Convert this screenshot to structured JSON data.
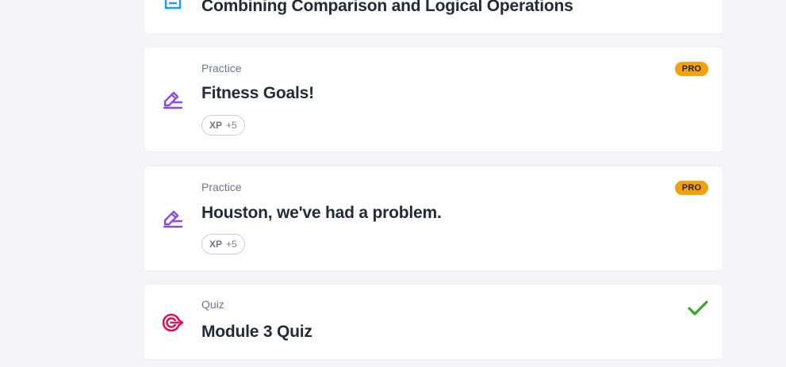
{
  "cards": [
    {
      "type_label": "",
      "title": "Combining Comparison and Logical Operations",
      "icon": "document-icon",
      "icon_color": "#1e9cf0"
    },
    {
      "type_label": "Practice",
      "title": "Fitness Goals!",
      "badge": "PRO",
      "xp_label": "XP",
      "xp_value": "+5",
      "icon": "pencil-icon",
      "icon_color": "#8a4fd8"
    },
    {
      "type_label": "Practice",
      "title": "Houston, we've had a problem.",
      "badge": "PRO",
      "xp_label": "XP",
      "xp_value": "+5",
      "icon": "pencil-icon",
      "icon_color": "#8a4fd8"
    },
    {
      "type_label": "Quiz",
      "title": "Module 3 Quiz",
      "icon": "target-icon",
      "icon_color": "#e0105a",
      "status": "completed",
      "status_icon": "check-icon",
      "status_color": "#3aa823"
    }
  ],
  "colors": {
    "background": "#f2f4f7",
    "pro_badge": "#f2a20d"
  }
}
